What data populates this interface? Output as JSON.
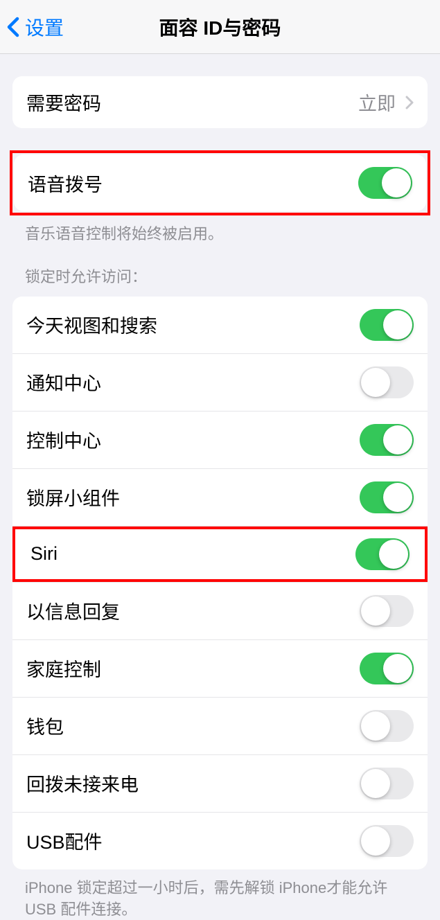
{
  "header": {
    "back_label": "设置",
    "title": "面容 ID与密码"
  },
  "passcode_row": {
    "label": "需要密码",
    "value": "立即"
  },
  "voice_dial": {
    "label": "语音拨号",
    "on": true,
    "footer": "音乐语音控制将始终被启用。"
  },
  "lock_access": {
    "header": "锁定时允许访问：",
    "items": [
      {
        "label": "今天视图和搜索",
        "on": true
      },
      {
        "label": "通知中心",
        "on": false
      },
      {
        "label": "控制中心",
        "on": true
      },
      {
        "label": "锁屏小组件",
        "on": true
      },
      {
        "label": "Siri",
        "on": true
      },
      {
        "label": "以信息回复",
        "on": false
      },
      {
        "label": "家庭控制",
        "on": true
      },
      {
        "label": "钱包",
        "on": false
      },
      {
        "label": "回拨未接来电",
        "on": false
      },
      {
        "label": "USB配件",
        "on": false
      }
    ],
    "footer": "iPhone 锁定超过一小时后，需先解锁 iPhone才能允许USB 配件连接。"
  }
}
